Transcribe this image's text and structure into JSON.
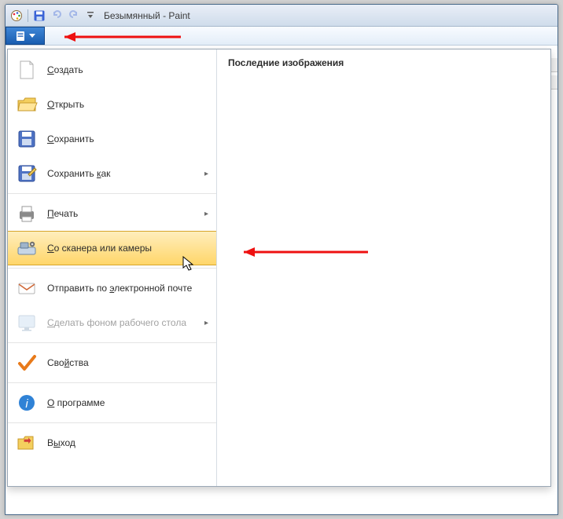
{
  "titlebar": {
    "title": "Безымянный - Paint"
  },
  "file_button": {
    "aria": "Файл"
  },
  "recent": {
    "heading": "Последние изображения"
  },
  "menu": {
    "new": {
      "label": "Создать"
    },
    "open": {
      "label": "Открыть"
    },
    "save": {
      "label": "Сохранить"
    },
    "saveas": {
      "label": "Сохранить как"
    },
    "print": {
      "label": "Печать"
    },
    "scanner": {
      "label": "Со сканера или камеры"
    },
    "email": {
      "label": "Отправить по электронной почте"
    },
    "wallpaper": {
      "label": "Сделать фоном рабочего стола"
    },
    "properties": {
      "label": "Свойства"
    },
    "about": {
      "label": "О программе"
    },
    "exit": {
      "label": "Выход"
    }
  }
}
